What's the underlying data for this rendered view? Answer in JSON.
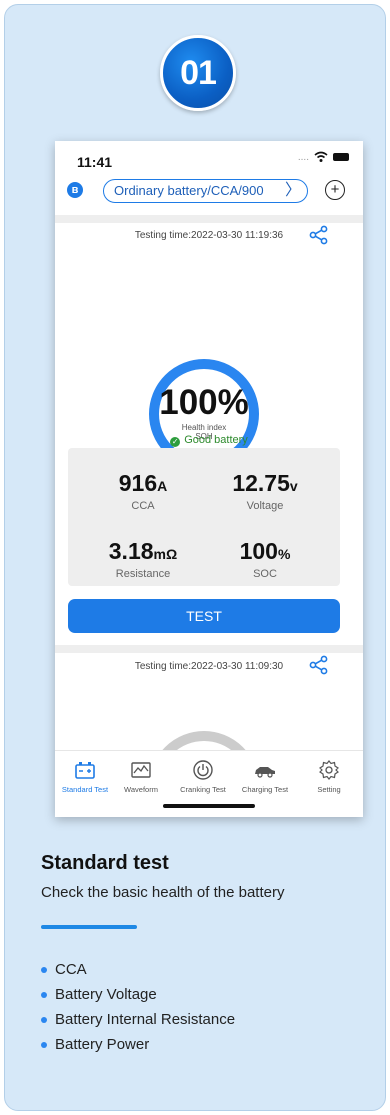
{
  "badge": {
    "number": "01"
  },
  "status_bar": {
    "time": "11:41",
    "signal": "...."
  },
  "header": {
    "battery_type": "Ordinary battery/CCA/900",
    "chevron": "〉",
    "plus": "+"
  },
  "results": [
    {
      "testing_time": "Testing time:2022-03-30 11:19:36",
      "health_pct": "100%",
      "health_label_1": "Health index",
      "health_label_2": "SOH",
      "status": "Good battery",
      "stats": {
        "cca": {
          "value": "916",
          "unit": "A",
          "label": "CCA"
        },
        "voltage": {
          "value": "12.75",
          "unit": "v",
          "label": "Voltage"
        },
        "resistance": {
          "value": "3.18",
          "unit": "mΩ",
          "label": "Resistance"
        },
        "soc": {
          "value": "100",
          "unit": "%",
          "label": "SOC"
        }
      },
      "test_button": "TEST"
    },
    {
      "testing_time": "Testing time:2022-03-30 11:09:30"
    }
  ],
  "tabs": [
    {
      "label": "Standard Test",
      "icon": "battery-icon",
      "active": true
    },
    {
      "label": "Waveform",
      "icon": "waveform-icon",
      "active": false
    },
    {
      "label": "Cranking Test",
      "icon": "power-icon",
      "active": false
    },
    {
      "label": "Charging Test",
      "icon": "car-icon",
      "active": false
    },
    {
      "label": "Setting",
      "icon": "gear-icon",
      "active": false
    }
  ],
  "colors": {
    "accent": "#1e7be6",
    "good": "#2e8b2e",
    "card_bg": "#d6e8f8"
  },
  "section": {
    "title": "Standard test",
    "subtitle": "Check the basic health of the battery",
    "bullets": [
      "CCA",
      "Battery Voltage",
      "Battery Internal Resistance",
      "Battery Power"
    ]
  }
}
